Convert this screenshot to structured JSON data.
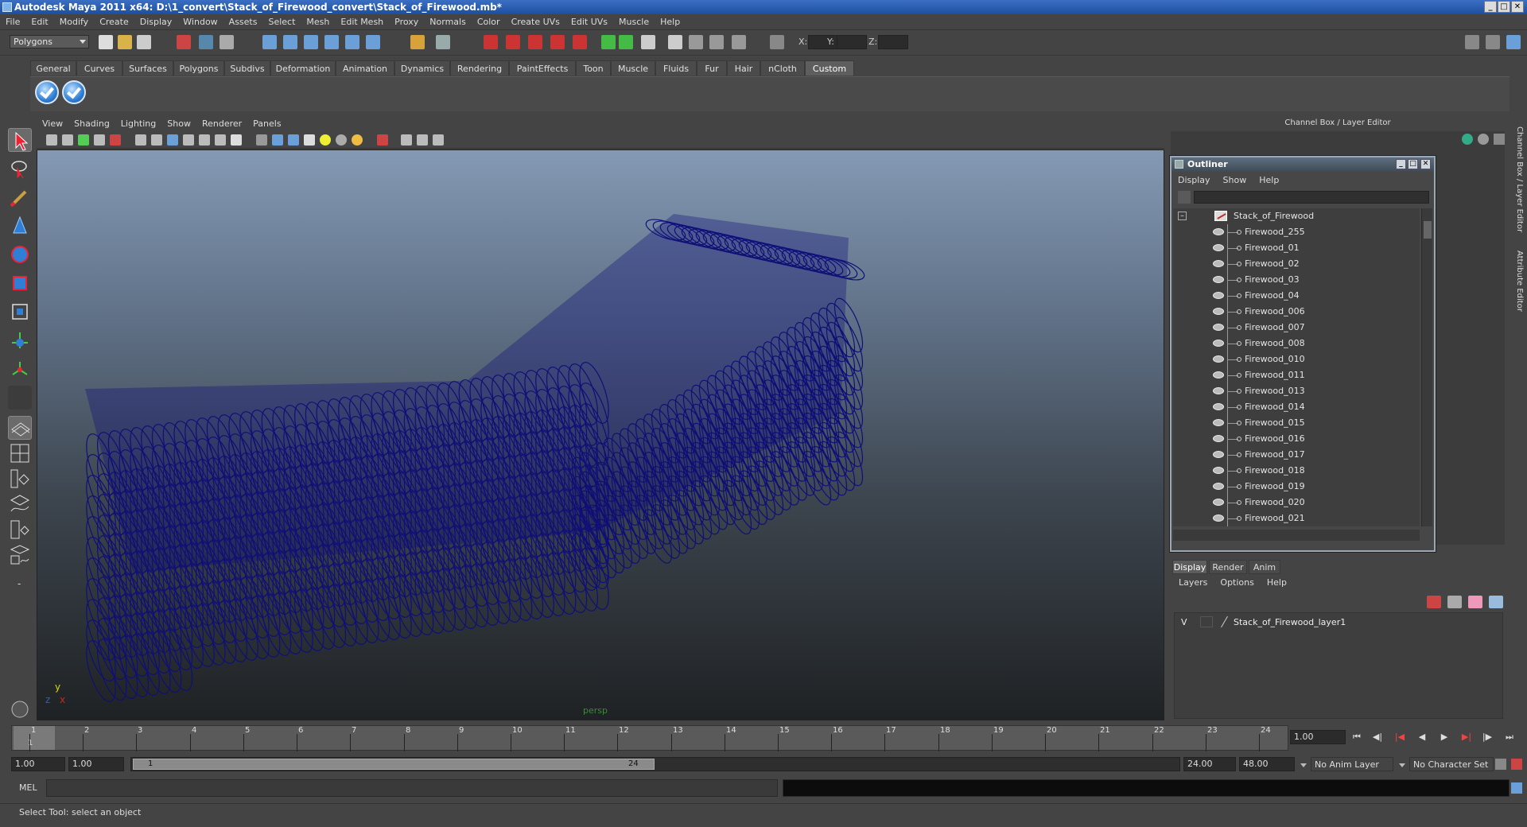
{
  "window": {
    "title": "Autodesk Maya 2011 x64: D:\\1_convert\\Stack_of_Firewood_convert\\Stack_of_Firewood.mb*",
    "controls": {
      "minimize": "_",
      "maximize": "□",
      "close": "✕"
    }
  },
  "menubar": [
    "File",
    "Edit",
    "Modify",
    "Create",
    "Display",
    "Window",
    "Assets",
    "Select",
    "Mesh",
    "Edit Mesh",
    "Proxy",
    "Normals",
    "Color",
    "Create UVs",
    "Edit UVs",
    "Muscle",
    "Help"
  ],
  "statusline": {
    "mode": "Polygons",
    "x_label": "X:",
    "y_label": "Y:",
    "z_label": "Z:"
  },
  "shelf": {
    "tabs": [
      "General",
      "Curves",
      "Surfaces",
      "Polygons",
      "Subdivs",
      "Deformation",
      "Animation",
      "Dynamics",
      "Rendering",
      "PaintEffects",
      "Toon",
      "Muscle",
      "Fluids",
      "Fur",
      "Hair",
      "nCloth",
      "Custom"
    ],
    "active_tab": "Custom"
  },
  "viewport": {
    "menu": [
      "View",
      "Shading",
      "Lighting",
      "Show",
      "Renderer",
      "Panels"
    ],
    "camera_label": "persp",
    "axis": {
      "x": "x",
      "y": "y",
      "z": "z"
    },
    "wire_color": "#0f0f78"
  },
  "channel_box": {
    "title": "Channel Box / Layer Editor",
    "side_tabs": [
      "Channel Box / Layer Editor",
      "Attribute Editor"
    ]
  },
  "outliner": {
    "title": "Outliner",
    "menu": [
      "Display",
      "Show",
      "Help"
    ],
    "root": "Stack_of_Firewood",
    "items": [
      "Firewood_255",
      "Firewood_01",
      "Firewood_02",
      "Firewood_03",
      "Firewood_04",
      "Firewood_006",
      "Firewood_007",
      "Firewood_008",
      "Firewood_010",
      "Firewood_011",
      "Firewood_013",
      "Firewood_014",
      "Firewood_015",
      "Firewood_016",
      "Firewood_017",
      "Firewood_018",
      "Firewood_019",
      "Firewood_020",
      "Firewood_021"
    ]
  },
  "layer_editor": {
    "tabs": [
      "Display",
      "Render",
      "Anim"
    ],
    "active_tab": "Display",
    "menu": [
      "Layers",
      "Options",
      "Help"
    ],
    "layer": {
      "visibility": "V",
      "name": "Stack_of_Firewood_layer1"
    }
  },
  "timeline": {
    "ticks": [
      "1",
      "2",
      "3",
      "4",
      "5",
      "6",
      "7",
      "8",
      "9",
      "10",
      "11",
      "12",
      "13",
      "14",
      "15",
      "16",
      "17",
      "18",
      "19",
      "20",
      "21",
      "22",
      "23",
      "24"
    ],
    "current_frame_marker": "1",
    "current_frame": "1.00"
  },
  "range": {
    "start_time": "1.00",
    "playback_start": "1.00",
    "handle_start": "1",
    "handle_end": "24",
    "playback_end": "24.00",
    "end_time": "48.00",
    "anim_layer": "No Anim Layer",
    "character_set": "No Character Set"
  },
  "command_line": {
    "label": "MEL"
  },
  "help_line": {
    "text": "Select Tool: select an object"
  }
}
